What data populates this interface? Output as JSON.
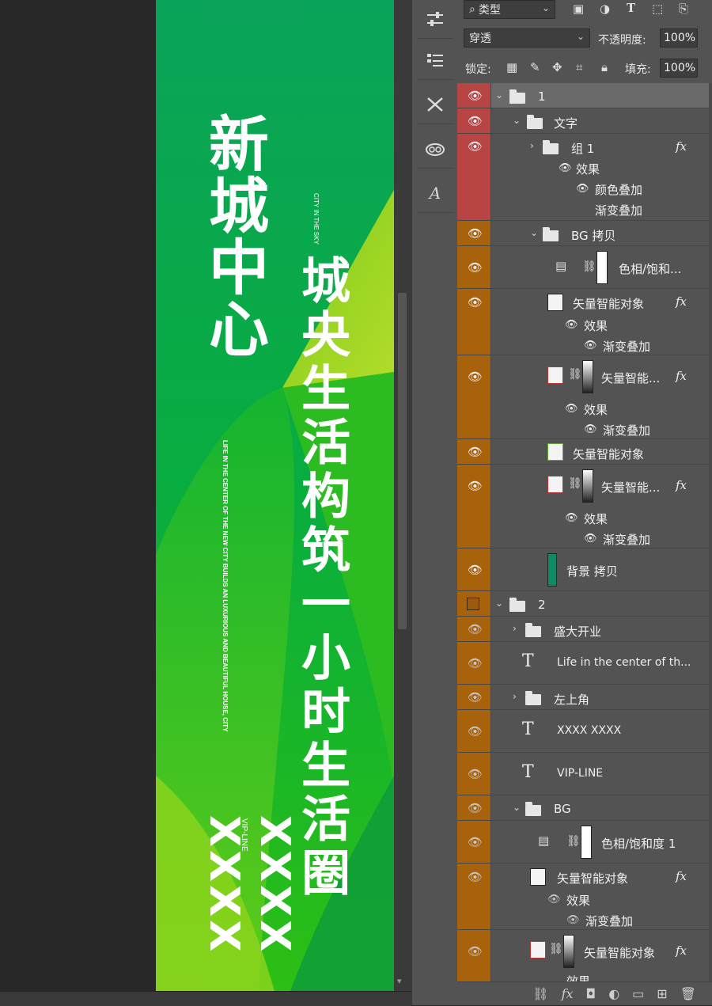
{
  "poster": {
    "title": "新城中心",
    "tag_line1": "CITY",
    "tag_line2": "IN THE SKY",
    "slogan": "城央生活构筑一小时生活圈",
    "english_line1": "LIFE IN THE CENTER OF THE NEW CITY BUILDS AN",
    "english_line2": "LUXURIOUS AND BEAUTIFUL HOUSE, CITY",
    "vip": "VIP-LINE",
    "bottom": "XXXX XXXX",
    "colors": {
      "main_green": "#0aa648",
      "light_green": "#9ccf1e",
      "dark_green": "#079a3a"
    }
  },
  "options": {
    "filter_kind": "类型",
    "blend_mode": "穿透",
    "opacity_label": "不透明度:",
    "opacity_value": "100%",
    "lock_label": "锁定:",
    "fill_label": "填充:",
    "fill_value": "100%"
  },
  "layers": {
    "g1": "1",
    "text_group": "文字",
    "group1": "组 1",
    "effects": "效果",
    "color_overlay": "颜色叠加",
    "gradient_overlay": "渐变叠加",
    "bg_copy": "BG 拷贝",
    "hue_sat_short": "色相/饱和...",
    "smart_object": "矢量智能对象",
    "smart_short": "矢量智能...",
    "background_copy": "背景 拷贝",
    "g2": "2",
    "grand_opening": "盛大开业",
    "life_text": "Life in the center of th...",
    "top_left": "左上角",
    "xxxx": "XXXX XXXX",
    "vip_line": "VIP-LINE",
    "bg": "BG",
    "hue_sat1": "色相/饱和度 1",
    "fx": "fx"
  },
  "icons": [
    "sliders-icon",
    "properties-icon",
    "tools-icon",
    "cloud-icon",
    "character-icon",
    "eye-icon",
    "folder-icon",
    "chain-icon",
    "trash-icon"
  ]
}
